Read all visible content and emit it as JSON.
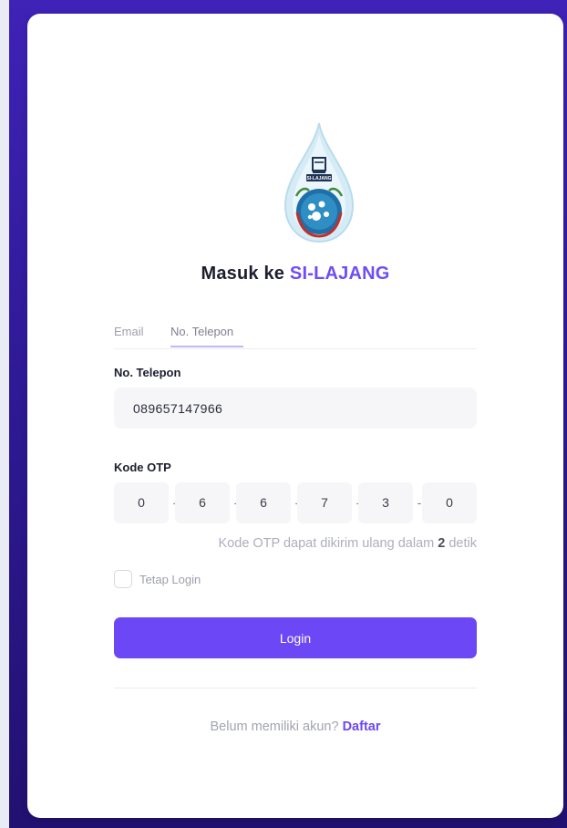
{
  "app": {
    "title_prefix": "Masuk ke",
    "title_brand": "SI-LAJANG",
    "logo_text": "SI-LAJANG"
  },
  "tabs": [
    {
      "label": "Email",
      "active": false
    },
    {
      "label": "No. Telepon",
      "active": true
    }
  ],
  "phone": {
    "label": "No. Telepon",
    "value": "089657147966"
  },
  "otp": {
    "label": "Kode OTP",
    "digits": [
      "0",
      "6",
      "6",
      "7",
      "3",
      "0"
    ],
    "separator": "-",
    "resend_prefix": "Kode OTP dapat dikirim ulang dalam",
    "resend_seconds": "2",
    "resend_suffix": "detik"
  },
  "remember": {
    "label": "Tetap Login",
    "checked": false
  },
  "login_button": "Login",
  "signup": {
    "prompt": "Belum memiliki akun?",
    "link": "Daftar"
  },
  "colors": {
    "accent": "#6c47f6",
    "background_panel": "#2f1a96",
    "card": "#ffffff"
  }
}
